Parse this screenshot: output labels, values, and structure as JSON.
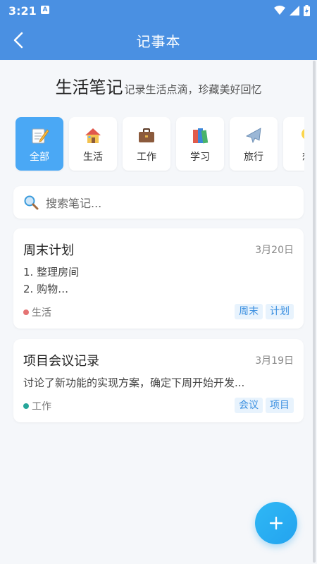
{
  "status_bar": {
    "time": "3:21",
    "notification_letter": "A"
  },
  "app_bar": {
    "title": "记事本"
  },
  "hero": {
    "title": "生活笔记",
    "subtitle": "记录生活点滴，珍藏美好回忆"
  },
  "categories": [
    {
      "label": "全部",
      "icon": "memo-pencil-icon",
      "active": true
    },
    {
      "label": "生活",
      "icon": "house-icon",
      "active": false
    },
    {
      "label": "工作",
      "icon": "briefcase-icon",
      "active": false
    },
    {
      "label": "学习",
      "icon": "books-icon",
      "active": false
    },
    {
      "label": "旅行",
      "icon": "airplane-icon",
      "active": false
    },
    {
      "label": "想",
      "icon": "lightbulb-icon",
      "active": false
    }
  ],
  "search": {
    "placeholder": "搜索笔记..."
  },
  "notes": [
    {
      "title": "周末计划",
      "date": "3月20日",
      "body": [
        "1. 整理房间",
        "2. 购物…"
      ],
      "category": "生活",
      "category_color": "#e57373",
      "tags": [
        "周末",
        "计划"
      ]
    },
    {
      "title": "项目会议记录",
      "date": "3月19日",
      "body": [
        "讨论了新功能的实现方案，确定下周开始开发..."
      ],
      "category": "工作",
      "category_color": "#26a69a",
      "tags": [
        "会议",
        "项目"
      ]
    }
  ],
  "colors": {
    "primary": "#4a90e2",
    "active_category": "#4aa8f5",
    "tag_bg": "#e8f3fd",
    "tag_text": "#3a8fe0",
    "fab": "#23a3ef"
  },
  "fab": {
    "icon": "plus-icon"
  }
}
